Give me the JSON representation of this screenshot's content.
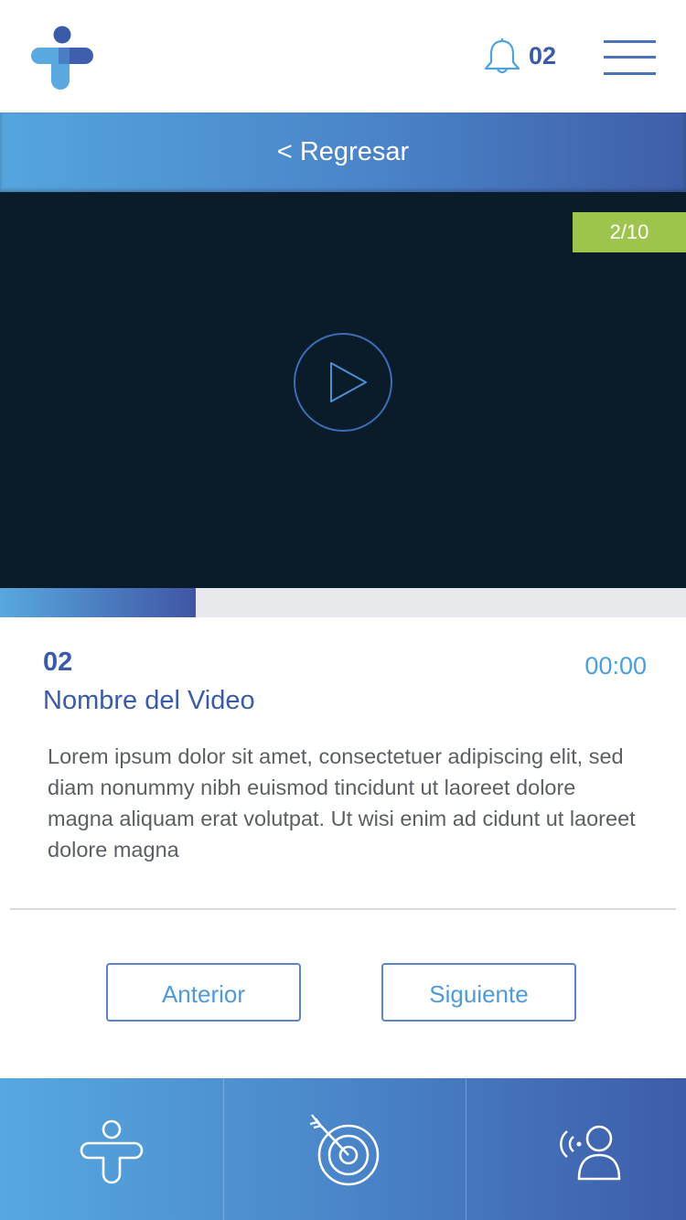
{
  "header": {
    "logo": "app-logo",
    "notifications_count": "02",
    "bell_icon": "bell-icon",
    "menu_icon": "hamburger-menu-icon"
  },
  "back": {
    "label": "< Regresar"
  },
  "video": {
    "counter": "2/10",
    "play_icon": "play-icon",
    "progress": 0.285
  },
  "details": {
    "number": "02",
    "duration": "00:00",
    "title": "Nombre del Video",
    "description": "Lorem ipsum dolor sit amet, consectetuer adipiscing elit, sed diam nonummy nibh euismod tincidunt ut laoreet dolore magna aliquam erat volutpat. Ut wisi enim ad cidunt ut laoreet dolore magna"
  },
  "buttons": {
    "previous": "Anterior",
    "next": "Siguiente"
  },
  "tabbar": {
    "items": [
      {
        "icon": "person-logo-icon"
      },
      {
        "icon": "target-icon"
      },
      {
        "icon": "profile-signal-icon"
      }
    ]
  },
  "colors": {
    "primary_dark": "#3a5ba8",
    "primary_light": "#55a5de",
    "accent_green": "#9dc44d",
    "video_bg": "#0a1b2a"
  }
}
